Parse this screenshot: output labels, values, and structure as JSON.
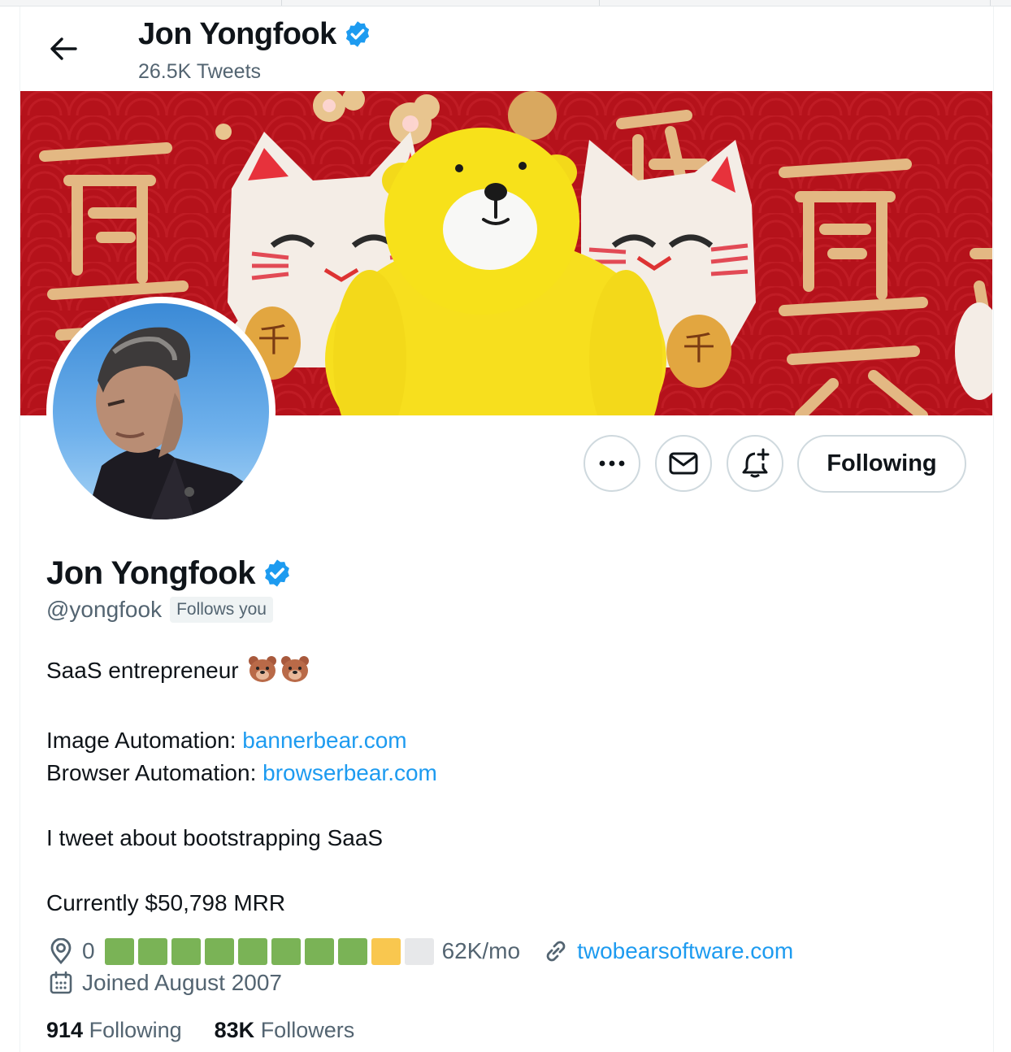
{
  "header": {
    "back_label": "Back",
    "name": "Jon Yongfook",
    "tweet_count": "26.5K Tweets"
  },
  "actions": {
    "more_label": "More",
    "message_label": "Message",
    "notify_label": "Turn on notifications",
    "following_label": "Following"
  },
  "profile": {
    "name": "Jon Yongfook",
    "handle": "@yongfook",
    "follows_you": "Follows you",
    "bio": {
      "line1": "SaaS entrepreneur",
      "image_automation_label": "Image Automation: ",
      "image_automation_link": "bannerbear.com",
      "browser_automation_label": "Browser Automation: ",
      "browser_automation_link": "browserbear.com",
      "line_tweets": "I tweet about bootstrapping SaaS",
      "line_mrr": "Currently $50,798 MRR"
    },
    "location_value": "0",
    "mrr_progress": {
      "filled": 8,
      "partial": 1,
      "empty": 1,
      "filled_color": "#7ab356",
      "partial_color": "#f9c74f",
      "empty_color": "#e7e8ea"
    },
    "location_suffix": "62K/mo",
    "website": "twobearsoftware.com",
    "joined": "Joined August 2007",
    "following_count": "914",
    "following_label": "Following",
    "followers_count": "83K",
    "followers_label": "Followers"
  },
  "colors": {
    "accent": "#1d9bf0",
    "verified": "#1d9bf0",
    "banner_red": "#b5121b",
    "bear_yellow": "#f7e11a"
  }
}
